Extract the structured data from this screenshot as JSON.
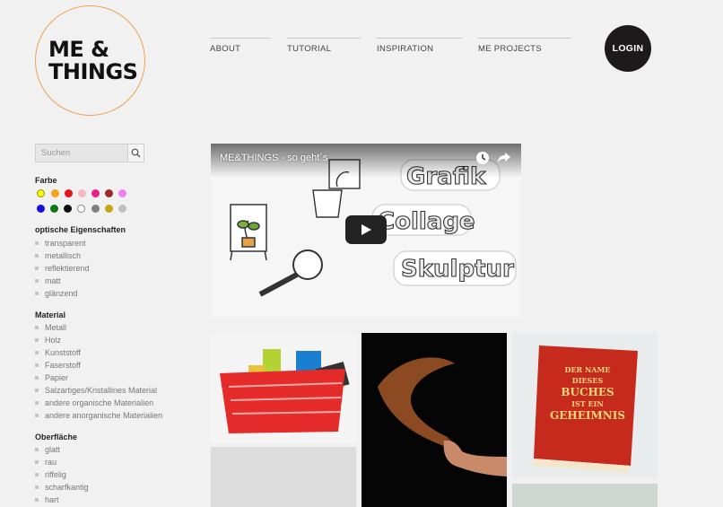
{
  "logo": {
    "text": "ME &\nTHINGS"
  },
  "nav": {
    "items": [
      "ABOUT",
      "TUTORIAL",
      "INSPIRATION",
      "ME PROJECTS"
    ]
  },
  "login": {
    "label": "LOGIN"
  },
  "search": {
    "placeholder": "Suchen"
  },
  "sidebar": {
    "farbe": {
      "title": "Farbe",
      "colors": [
        "#ffff00",
        "#f7a21b",
        "#e8131b",
        "#f7b6c2",
        "#ec1c8c",
        "#9c2a2a",
        "#ee82ee",
        "#1414d8",
        "#0e7a0e",
        "#111111",
        "#ffffff",
        "#808080",
        "#c9a215",
        "#c0c0c0"
      ]
    },
    "optische": {
      "title": "optische Eigenschaften",
      "items": [
        "transparent",
        "metallisch",
        "reflektierend",
        "matt",
        "glänzend"
      ]
    },
    "material": {
      "title": "Material",
      "items": [
        "Metall",
        "Holz",
        "Kunststoff",
        "Faserstoff",
        "Papier",
        "Salzartiges/Kristallines Material",
        "andere organische Materialien",
        "andere anorganische Materialien"
      ]
    },
    "oberflaeche": {
      "title": "Oberfläche",
      "items": [
        "glatt",
        "rau",
        "riffelig",
        "scharfkantig",
        "hart"
      ]
    }
  },
  "video": {
    "title": "ME&THINGS - so geht´s",
    "words": [
      "Grafik",
      "Collage",
      "Skulptur"
    ]
  },
  "book": {
    "title_lines": [
      "DER NAME",
      "DIESES",
      "BUCHES",
      "IST EIN",
      "GEHEIMNIS"
    ]
  }
}
